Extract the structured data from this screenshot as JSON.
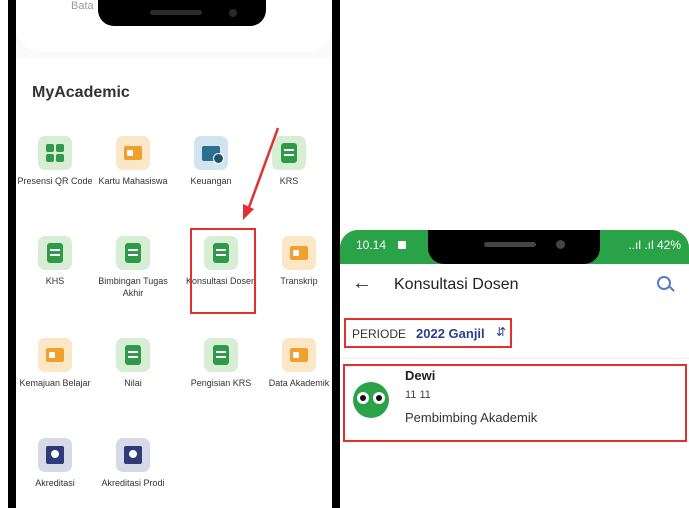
{
  "phone1": {
    "previous_text": "Bata",
    "section_title": "MyAcademic",
    "tiles": [
      {
        "label": "Presensi QR Code",
        "icon": "qr-icon"
      },
      {
        "label": "Kartu Mahasiswa",
        "icon": "id-card-icon"
      },
      {
        "label": "Keuangan",
        "icon": "finance-icon"
      },
      {
        "label": "KRS",
        "icon": "document-icon"
      },
      {
        "label": "KHS",
        "icon": "document-icon"
      },
      {
        "label": "Bimbingan Tugas Akhir",
        "icon": "edit-icon"
      },
      {
        "label": "Konsultasi Dosen",
        "icon": "chat-user-icon"
      },
      {
        "label": "Transkrip",
        "icon": "transcript-icon"
      },
      {
        "label": "Kemajuan Belajar",
        "icon": "progress-icon"
      },
      {
        "label": "Nilai",
        "icon": "grade-icon"
      },
      {
        "label": "Pengisian KRS",
        "icon": "document-icon"
      },
      {
        "label": "Data Akademik",
        "icon": "data-icon"
      },
      {
        "label": "Akreditasi",
        "icon": "accreditation-icon"
      },
      {
        "label": "Akreditasi Prodi",
        "icon": "accreditation-prodi-icon"
      }
    ]
  },
  "phone2": {
    "status_time": "10.14",
    "status_right": "..ıl .ıl 42%",
    "title": "Konsultasi Dosen",
    "periode_label": "PERIODE",
    "periode_value": "2022 Ganjil",
    "item": {
      "name": "Dewi",
      "code": "11 11",
      "role": "Pembimbing Akademik"
    }
  },
  "colors": {
    "highlight": "#e03030",
    "brand_green": "#2aa247",
    "accent_blue": "#2c3e8f"
  }
}
